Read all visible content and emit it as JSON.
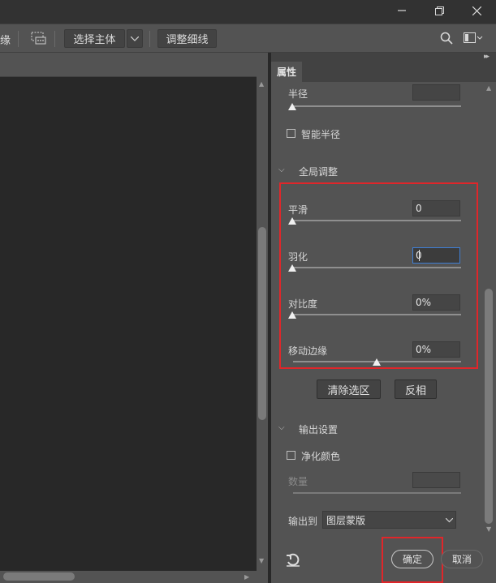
{
  "toolbar": {
    "partial_label": "缘",
    "select_subject": "选择主体",
    "refine_hair": "调整细线"
  },
  "panel": {
    "tab_label": "属性",
    "radius": {
      "label": "半径",
      "value": "",
      "slider": 0
    },
    "smart_radius": {
      "label": "智能半径",
      "checked": false
    },
    "global_section": "全局调整",
    "smooth": {
      "label": "平滑",
      "value": "0",
      "slider": 0
    },
    "feather": {
      "label": "羽化",
      "value": "0",
      "slider": 0
    },
    "contrast": {
      "label": "对比度",
      "value": "0%",
      "slider": 0
    },
    "shift_edge": {
      "label": "移动边缘",
      "value": "0%",
      "slider": 0.5
    },
    "clear_selection": "清除选区",
    "invert": "反相",
    "output_section": "输出设置",
    "decontaminate": {
      "label": "净化颜色",
      "checked": false
    },
    "amount": {
      "label": "数量",
      "value": ""
    },
    "output_to": {
      "label": "输出到",
      "value": "图层蒙版"
    },
    "ok": "确定",
    "cancel": "取消"
  },
  "colors": {
    "highlight": "#e0262a",
    "focus": "#3f7fd5"
  }
}
